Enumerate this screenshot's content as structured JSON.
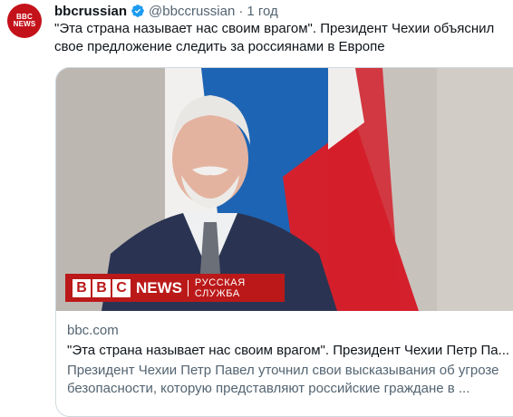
{
  "account": {
    "avatar_line1": "BBC",
    "avatar_line2": "NEWS",
    "display_name": "bbcrussian",
    "handle": "@bbccrussian",
    "separator": "·",
    "time": "1 год"
  },
  "tweet": {
    "text": "\"Эта страна называет нас своим врагом\". Президент Чехии объяснил свое предложение следить за россиянами в Европе"
  },
  "card": {
    "banner": {
      "letters": [
        "B",
        "B",
        "C"
      ],
      "news": "NEWS",
      "service": "РУССКАЯ СЛУЖБА"
    },
    "domain": "bbc.com",
    "title": "\"Эта страна называет нас своим врагом\". Президент Чехии Петр Па...",
    "description": "Президент Чехии Петр Павел уточнил свои высказывания об угрозе безопасности, которую представляют российские граждане в ..."
  },
  "colors": {
    "bbc_red": "#bb1919",
    "verified_blue": "#1d9bf0",
    "secondary_text": "#536471"
  }
}
